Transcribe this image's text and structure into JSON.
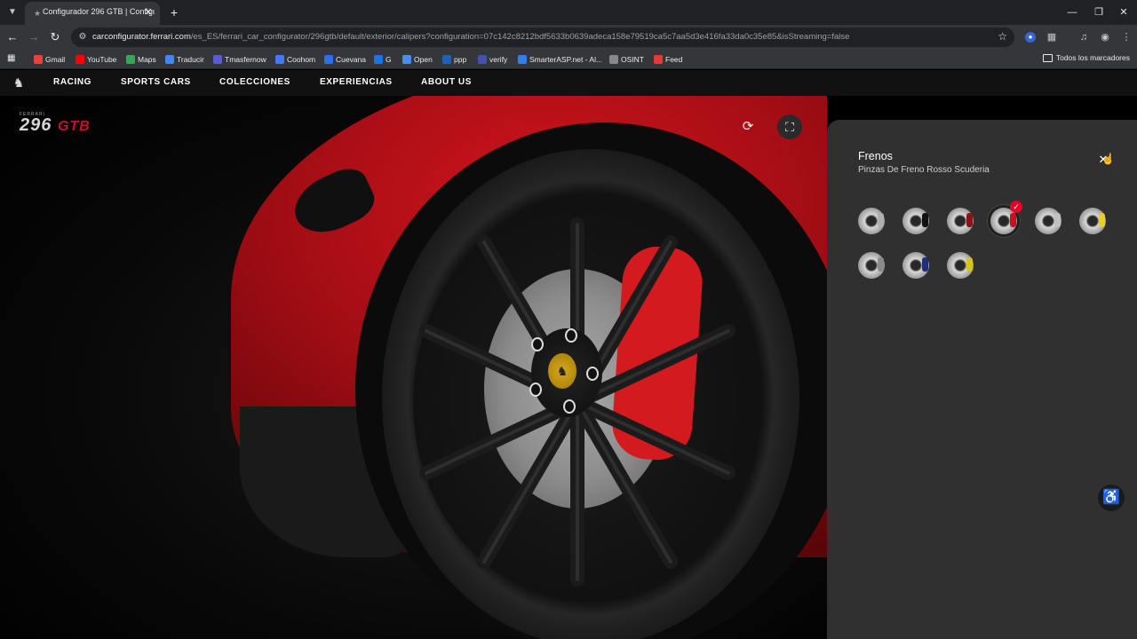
{
  "browser": {
    "tab_title": "Configurador 296 GTB | Configu",
    "url_host": "carconfigurator.ferrari.com",
    "url_path": "/es_ES/ferrari_car_configurator/296gtb/default/exterior/calipers?configuration=07c142c8212bdf5633b0639adeca158e79519ca5c7aa5d3e416fa33da0c35e85&isStreaming=false",
    "bookmarks": [
      {
        "label": "Gmail",
        "color": "#ea4335"
      },
      {
        "label": "YouTube",
        "color": "#ff0000"
      },
      {
        "label": "Maps",
        "color": "#34a853"
      },
      {
        "label": "Traducir",
        "color": "#4285f4"
      },
      {
        "label": "Tmasfernow",
        "color": "#5b5bd6"
      },
      {
        "label": "Coohom",
        "color": "#3f7cf4"
      },
      {
        "label": "Cuevana",
        "color": "#2b6ef0"
      },
      {
        "label": "G",
        "color": "#1a73e8"
      },
      {
        "label": "Open",
        "color": "#4b8bf5"
      },
      {
        "label": "ppp",
        "color": "#1565c0"
      },
      {
        "label": "verify",
        "color": "#3f51b5"
      },
      {
        "label": "SmarterASP.net - Al...",
        "color": "#2f80ed"
      },
      {
        "label": "OSINT",
        "color": "#888888"
      },
      {
        "label": "Feed",
        "color": "#e53935"
      }
    ],
    "all_bookmarks": "Todos los marcadores"
  },
  "site": {
    "menu": [
      "RACING",
      "SPORTS CARS",
      "COLECCIONES",
      "EXPERIENCIAS",
      "ABOUT US"
    ],
    "car_logo_brand": "FERRARI",
    "car_logo_model_num": "296",
    "car_logo_model_suffix": "GTB"
  },
  "panel": {
    "title": "Frenos",
    "subtitle": "Pinzas De Freno Rosso Scuderia",
    "options": [
      {
        "name": "caliper-option-1",
        "caliper_color": "#b0b0b0",
        "selected": false
      },
      {
        "name": "caliper-option-2",
        "caliper_color": "#111111",
        "selected": false
      },
      {
        "name": "caliper-option-3",
        "caliper_color": "#8a1418",
        "selected": false
      },
      {
        "name": "caliper-option-4",
        "caliper_color": "#c8101e",
        "selected": true
      },
      {
        "name": "caliper-option-5",
        "caliper_color": "#c0c0c0",
        "selected": false
      },
      {
        "name": "caliper-option-6",
        "caliper_color": "#e6d21a",
        "selected": false
      },
      {
        "name": "caliper-option-7",
        "caliper_color": "#8a8a8a",
        "selected": false
      },
      {
        "name": "caliper-option-8",
        "caliper_color": "#1f2f7a",
        "selected": false
      },
      {
        "name": "caliper-option-9",
        "caliper_color": "#d9c21a",
        "selected": false
      }
    ]
  }
}
